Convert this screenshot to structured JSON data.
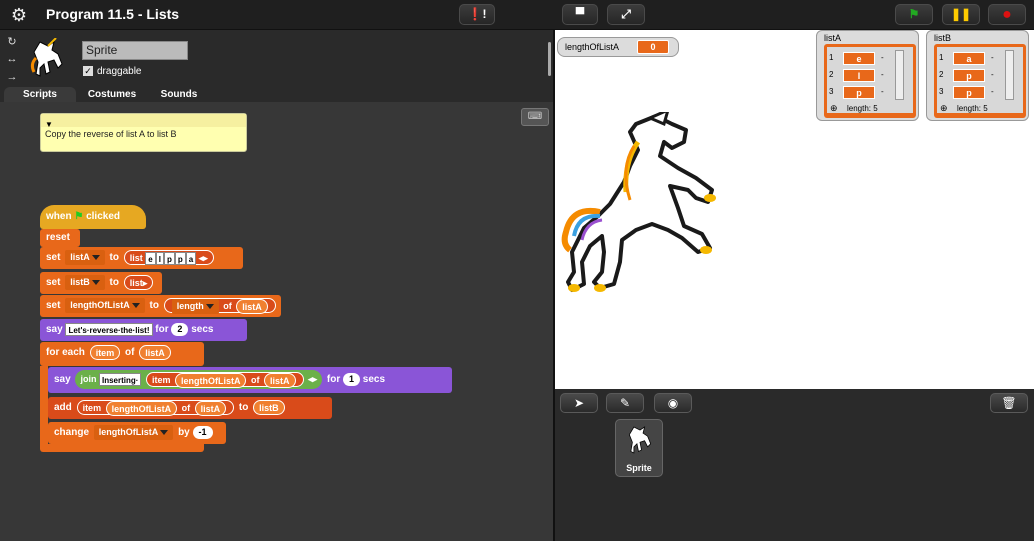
{
  "app": {
    "title": "Program 11.5 - Lists"
  },
  "sprite": {
    "name": "Sprite",
    "draggable_label": "draggable",
    "draggable_checked": true
  },
  "tabs": [
    "Scripts",
    "Costumes",
    "Sounds"
  ],
  "comment": {
    "text": "Copy the reverse of list A to list B"
  },
  "script": {
    "hat": {
      "when": "when",
      "clicked": "clicked"
    },
    "reset": "reset",
    "set1": {
      "set": "set",
      "var": "listA",
      "to": "to",
      "list": "list",
      "items": [
        "e",
        "l",
        "p",
        "p",
        "a"
      ]
    },
    "set2": {
      "set": "set",
      "var": "listB",
      "to": "to",
      "list": "list"
    },
    "set3": {
      "set": "set",
      "var": "lengthOfListA",
      "to": "to",
      "length": "length",
      "of": "of",
      "listvar": "listA"
    },
    "say1": {
      "say": "say",
      "text": "Let's·reverse·the·list!",
      "for": "for",
      "secs_val": "2",
      "secs": "secs"
    },
    "foreach": {
      "label": "for each",
      "item": "item",
      "of": "of",
      "listvar": "listA"
    },
    "say2": {
      "say": "say",
      "join": "join",
      "text": "Inserting·",
      "item": "item",
      "lengthvar": "lengthOfListA",
      "of": "of",
      "listvar": "listA",
      "for": "for",
      "secs_val": "1",
      "secs": "secs"
    },
    "add": {
      "add": "add",
      "item": "item",
      "lengthvar": "lengthOfListA",
      "of": "of",
      "listvar": "listA",
      "to": "to",
      "target": "listB"
    },
    "change": {
      "change": "change",
      "var": "lengthOfListA",
      "by": "by",
      "val": "-1"
    }
  },
  "watchers": {
    "lengthOfListA": {
      "label": "lengthOfListA",
      "value": "0"
    },
    "listA": {
      "title": "listA",
      "items": [
        {
          "i": "1",
          "v": "e"
        },
        {
          "i": "2",
          "v": "l"
        },
        {
          "i": "3",
          "v": "p"
        }
      ],
      "length_label": "length: 5"
    },
    "listB": {
      "title": "listB",
      "items": [
        {
          "i": "1",
          "v": "a"
        },
        {
          "i": "2",
          "v": "p"
        },
        {
          "i": "3",
          "v": "p"
        }
      ],
      "length_label": "length: 5"
    }
  },
  "corral": {
    "sprite_label": "Sprite"
  },
  "colors": {
    "control": "#e6a822",
    "variables": "#e8681a",
    "looks": "#8a55d7",
    "lists": "#d94b1a",
    "operators": "#6bb04a",
    "flag": "#22aa22",
    "pause": "#ffcc00",
    "stop": "#cc1111"
  },
  "icons": {
    "settings": "gear-icon",
    "flag": "green-flag-icon",
    "pause": "pause-icon",
    "stop": "stop-icon",
    "trash": "trash-icon"
  }
}
